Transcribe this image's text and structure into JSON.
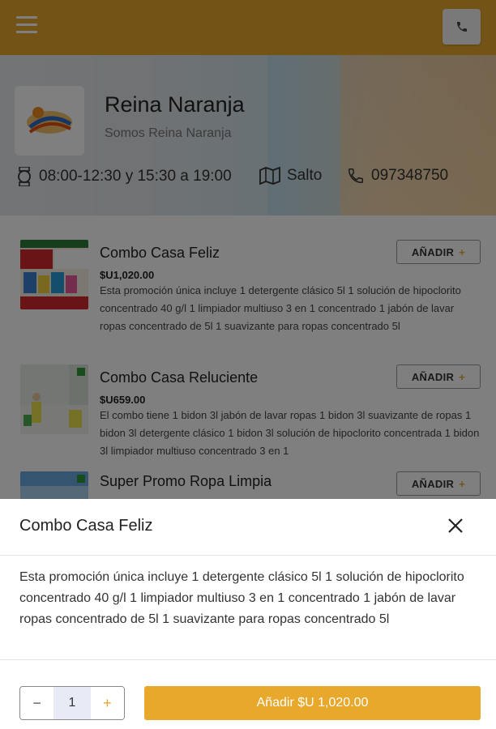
{
  "theme": {
    "accent": "#e8a82c",
    "backdrop": "rgba(0,0,0,0.5)"
  },
  "topbar": {
    "menu_icon": "hamburger-icon",
    "phone_icon": "phone-icon"
  },
  "store": {
    "logo_alt": "Reina Naranja",
    "name": "Reina Naranja",
    "tagline": "Somos Reina Naranja",
    "hours": "08:00-12:30 y 15:30 a 19:00",
    "city": "Salto",
    "phone": "097348750"
  },
  "products": [
    {
      "title": "Combo Casa Feliz",
      "price": "$U1,020.00",
      "description": "Esta promoción única incluye 1 detergente clásico 5l 1 solución de hipoclorito concentrado 40 g/l 1 limpiador multiuso 3 en 1 concentrado 1 jabón de lavar ropas concentrado de 5l 1 suavizante para ropas concentrado 5l",
      "add_label": "AÑADIR"
    },
    {
      "title": "Combo Casa Reluciente",
      "price": "$U659.00",
      "description": "El combo tiene 1 bidon 3l jabón de lavar ropas 1 bidon 3l suavizante de ropas 1 bidon 3l detergente clásico 1 bidon 3l solución de hipoclorito concentrada 1 bidon 3l limpiador multiuso concentrado 3 en 1",
      "add_label": "AÑADIR"
    },
    {
      "title": "Super Promo Ropa Limpia",
      "add_label": "AÑADIR"
    }
  ],
  "modal": {
    "title": "Combo Casa Feliz",
    "description": "Esta promoción única incluye 1 detergente clásico 5l 1 solución de hipoclorito concentrado 40 g/l 1 limpiador multiuso 3 en 1 concentrado 1 jabón de lavar ropas concentrado de 5l 1 suavizante para ropas concentrado 5l",
    "quantity": "1",
    "minus": "−",
    "plus": "+",
    "add_button": "Añadir $U 1,020.00"
  }
}
